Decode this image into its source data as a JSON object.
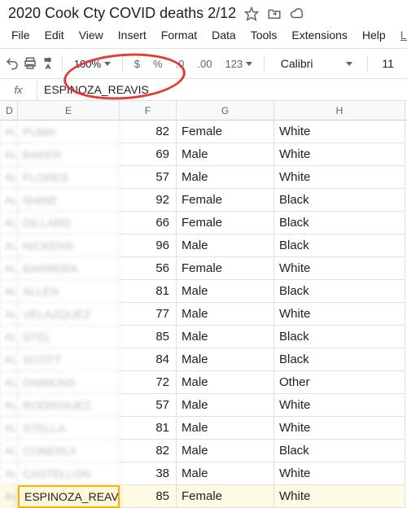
{
  "doc": {
    "title": "2020 Cook Cty COVID deaths 2/12"
  },
  "menu": {
    "file": "File",
    "edit": "Edit",
    "view": "View",
    "insert": "Insert",
    "format": "Format",
    "data": "Data",
    "tools": "Tools",
    "extensions": "Extensions",
    "help": "Help",
    "last": "Las"
  },
  "toolbar": {
    "zoom": "100%",
    "currency": "$",
    "percent": "%",
    "dec_dec": ".0",
    "dec_inc": ".00",
    "num_fmt": "123",
    "font": "Calibri",
    "font_size": "11"
  },
  "formula": {
    "fx": "fx",
    "value": "ESPINOZA_REAVIS"
  },
  "columns": {
    "D": "D",
    "E": "E",
    "F": "F",
    "G": "G",
    "H": "H"
  },
  "rows": [
    {
      "d": "AL",
      "e": "PUMA",
      "f": "82",
      "g": "Female",
      "h": "White"
    },
    {
      "d": "AL",
      "e": "BAKER",
      "f": "69",
      "g": "Male",
      "h": "White"
    },
    {
      "d": "AL",
      "e": "FLORES",
      "f": "57",
      "g": "Male",
      "h": "White"
    },
    {
      "d": "AL",
      "e": "SHINE",
      "f": "92",
      "g": "Female",
      "h": "Black"
    },
    {
      "d": "AL",
      "e": "DILLARD",
      "f": "66",
      "g": "Female",
      "h": "Black"
    },
    {
      "d": "AL",
      "e": "NICKENS",
      "f": "96",
      "g": "Male",
      "h": "Black"
    },
    {
      "d": "AL",
      "e": "BARRERA",
      "f": "56",
      "g": "Female",
      "h": "White"
    },
    {
      "d": "AL",
      "e": "ALLEN",
      "f": "81",
      "g": "Male",
      "h": "Black"
    },
    {
      "d": "AL",
      "e": "VELAZQUEZ",
      "f": "77",
      "g": "Male",
      "h": "White"
    },
    {
      "d": "AL",
      "e": "STEL",
      "f": "85",
      "g": "Male",
      "h": "Black"
    },
    {
      "d": "AL",
      "e": "SCOTT",
      "f": "84",
      "g": "Male",
      "h": "Black"
    },
    {
      "d": "AL",
      "e": "DAWKINS",
      "f": "72",
      "g": "Male",
      "h": "Other"
    },
    {
      "d": "AL",
      "e": "RODRIGUEZ",
      "f": "57",
      "g": "Male",
      "h": "White"
    },
    {
      "d": "AL",
      "e": "STELLA",
      "f": "81",
      "g": "Male",
      "h": "White"
    },
    {
      "d": "AL",
      "e": "CONERLY",
      "f": "82",
      "g": "Male",
      "h": "Black"
    },
    {
      "d": "AL",
      "e": "CASTELLON",
      "f": "38",
      "g": "Male",
      "h": "White"
    },
    {
      "d": "AL",
      "e": "ESPINOZA_REAV",
      "f": "85",
      "g": "Female",
      "h": "White",
      "highlight": true
    }
  ]
}
